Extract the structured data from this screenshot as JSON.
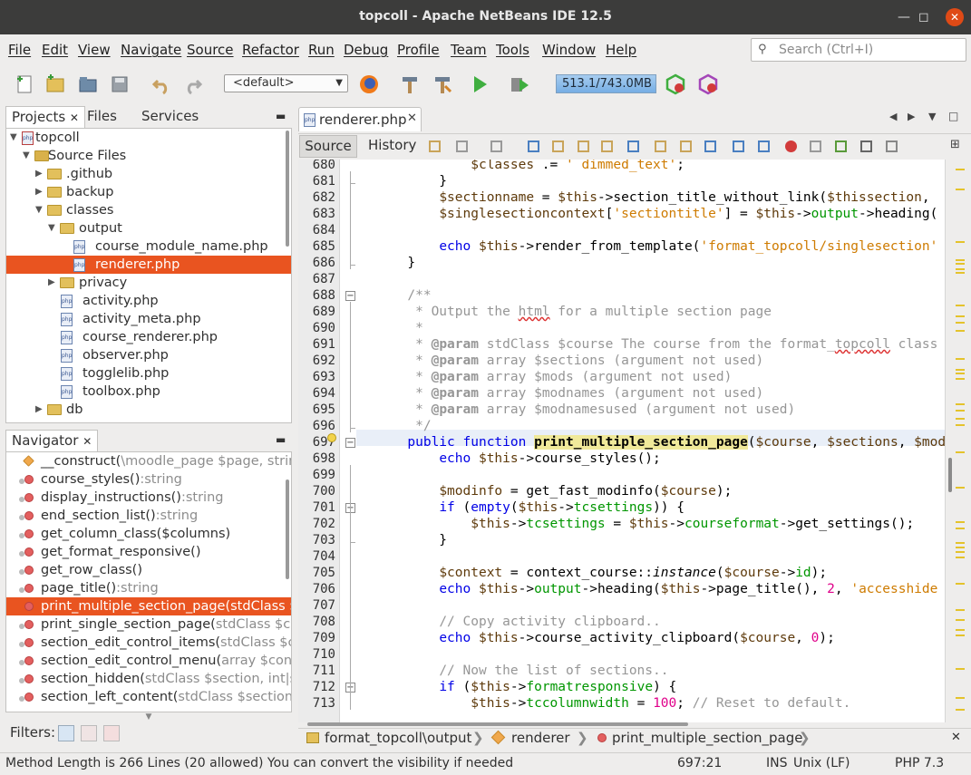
{
  "window": {
    "title": "topcoll - Apache NetBeans IDE 12.5"
  },
  "menu": [
    "File",
    "Edit",
    "View",
    "Navigate",
    "Source",
    "Refactor",
    "Run",
    "Debug",
    "Profile",
    "Team",
    "Tools",
    "Window",
    "Help"
  ],
  "search": {
    "placeholder": "Search (Ctrl+I)"
  },
  "toolbar": {
    "config": "<default>",
    "memory": "513.1/743.0MB"
  },
  "projects_panel": {
    "tabs": [
      "Projects",
      "Files",
      "Services"
    ],
    "tree": [
      {
        "label": "topcoll",
        "depth": 0,
        "type": "project"
      },
      {
        "label": "Source Files",
        "depth": 1,
        "type": "source"
      },
      {
        "label": ".github",
        "depth": 2,
        "type": "folder"
      },
      {
        "label": "backup",
        "depth": 2,
        "type": "folder"
      },
      {
        "label": "classes",
        "depth": 2,
        "type": "folder"
      },
      {
        "label": "output",
        "depth": 3,
        "type": "folder"
      },
      {
        "label": "course_module_name.php",
        "depth": 4,
        "type": "php"
      },
      {
        "label": "renderer.php",
        "depth": 4,
        "type": "php",
        "selected": true
      },
      {
        "label": "privacy",
        "depth": 3,
        "type": "folder"
      },
      {
        "label": "activity.php",
        "depth": 3,
        "type": "php"
      },
      {
        "label": "activity_meta.php",
        "depth": 3,
        "type": "php"
      },
      {
        "label": "course_renderer.php",
        "depth": 3,
        "type": "php"
      },
      {
        "label": "observer.php",
        "depth": 3,
        "type": "php"
      },
      {
        "label": "togglelib.php",
        "depth": 3,
        "type": "php"
      },
      {
        "label": "toolbox.php",
        "depth": 3,
        "type": "php"
      },
      {
        "label": "db",
        "depth": 2,
        "type": "folder"
      }
    ]
  },
  "navigator": {
    "title": "Navigator",
    "items": [
      {
        "name": "__construct(",
        "detail": "\\moodle_page $page, strin",
        "icon": "constructor"
      },
      {
        "name": "course_styles()",
        "detail": ":string"
      },
      {
        "name": "display_instructions()",
        "detail": ":string"
      },
      {
        "name": "end_section_list()",
        "detail": ":string"
      },
      {
        "name": "get_column_class($columns)",
        "detail": ""
      },
      {
        "name": "get_format_responsive()",
        "detail": ""
      },
      {
        "name": "get_row_class()",
        "detail": ""
      },
      {
        "name": "page_title()",
        "detail": ":string"
      },
      {
        "name": "print_multiple_section_page(stdClass $",
        "detail": "",
        "selected": true
      },
      {
        "name": "print_single_section_page(",
        "detail": "stdClass $co"
      },
      {
        "name": "section_edit_control_items(",
        "detail": "stdClass $c"
      },
      {
        "name": "section_edit_control_menu(",
        "detail": "array $con"
      },
      {
        "name": "section_hidden(",
        "detail": "stdClass $section, int|s"
      },
      {
        "name": "section_left_content(",
        "detail": "stdClass $section"
      }
    ],
    "filters_label": "Filters:"
  },
  "editor": {
    "tab": "renderer.php",
    "source_label": "Source",
    "history_label": "History",
    "lines": [
      680,
      681,
      682,
      683,
      684,
      685,
      686,
      687,
      688,
      689,
      690,
      691,
      692,
      693,
      694,
      695,
      696,
      697,
      698,
      699,
      700,
      701,
      702,
      703,
      704,
      705,
      706,
      707,
      708,
      709,
      710,
      711,
      712,
      713
    ]
  },
  "breadcrumb": [
    "format_topcoll\\output",
    "renderer",
    "print_multiple_section_page"
  ],
  "status": {
    "message": "Method Length is 266 Lines (20 allowed)  You can convert the visibility if needed",
    "position": "697:21",
    "mode": "INS",
    "eol": "Unix (LF)",
    "language": "PHP 7.3"
  }
}
